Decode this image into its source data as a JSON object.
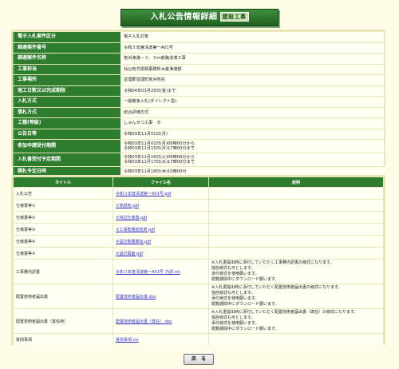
{
  "header": {
    "title": "入札公告情報詳細",
    "tag": "建設工事"
  },
  "info_rows": [
    {
      "label": "電子入札案件区分",
      "value": "電子入札対象"
    },
    {
      "label": "調達案件番号",
      "value": "令和３年度清波第一A01号"
    },
    {
      "label": "調達案件名称",
      "value": "荒浜漁港－３．５ｍ航路浚渫工事"
    },
    {
      "label": "工事担当",
      "value": "仙台地方振興事務所水産漁港部"
    },
    {
      "label": "工事場所",
      "value": "亘理郡亘理町荒浜地先"
    },
    {
      "label": "施工日数又は完成期限",
      "value": "令和04年03月25日(金)まで"
    },
    {
      "label": "入札方式",
      "value": "一般競争入札(ダイレクト型)"
    },
    {
      "label": "落札方式",
      "value": "総合評価方式"
    },
    {
      "label": "工種(等級)",
      "value": "しゅんせつ工事　Ｂ"
    },
    {
      "label": "公告日等",
      "value": "令和03年11月01日(月)"
    },
    {
      "label": "参加申請受付期間",
      "value_lines": [
        "令和03年11月01日(月)09時00分から",
        "令和03年11月15日(月)17時00分まで"
      ]
    },
    {
      "label": "入札書受付予定期間",
      "value_lines": [
        "令和03年11月16日(火)09時00分から",
        "令和03年11月17日(水)17時00分まで"
      ]
    },
    {
      "label": "開札予定日時",
      "value": "令和03年11月18日(木)10時00分"
    }
  ],
  "files_table": {
    "headers": {
      "title": "タイトル",
      "file": "ファイル名",
      "desc": "説明"
    },
    "rows": [
      {
        "title": "入札公告",
        "file": "令和３年度清波第一A01号.pdf",
        "desc": []
      },
      {
        "title": "仕様書等①",
        "file": "①表紙他.pdf",
        "desc": []
      },
      {
        "title": "仕様書等②",
        "file": "②特記仕様書.pdf",
        "desc": []
      },
      {
        "title": "仕様書等③",
        "file": "③工事数量総括表.pdf",
        "desc": []
      },
      {
        "title": "仕様書等④",
        "file": "④設計数量算出.pdf",
        "desc": []
      },
      {
        "title": "仕様書等⑤",
        "file": "⑤設計図面.pdf",
        "desc": []
      },
      {
        "title": "工事費内訳書",
        "file": "令和３年度清波第一A01号_内訳.xls",
        "desc": [
          "※入札書提出時に添付していただく工事費内訳書の様式になります。",
          "独自様式も可とします。",
          "添付様式を使用願います。",
          "閲覧期間中にダウンロード願います。"
        ]
      },
      {
        "title": "配置技術者届出書",
        "file": "配置技術者届出書.doc",
        "desc": [
          "※入札書提出時に添付していただく配置技術者届出書の様式になります。",
          "独自様式も可とします。",
          "添付様式を使用願います。",
          "閲覧期間中にダウンロード願います。"
        ]
      },
      {
        "title": "配置技術者届出書（専任用）",
        "file": "配置技術者届出書（専任）.doc",
        "desc": [
          "※入札書提出時に添付していただく配置技術者届出書（専任）の様式になります。",
          "独自様式も可とします。",
          "添付様式を使用願います。",
          "閲覧期間中にダウンロード願います。"
        ]
      },
      {
        "title": "質問事項",
        "file": "質問事項.xls",
        "desc": []
      }
    ]
  },
  "footer": {
    "back_label": "戻　る"
  }
}
